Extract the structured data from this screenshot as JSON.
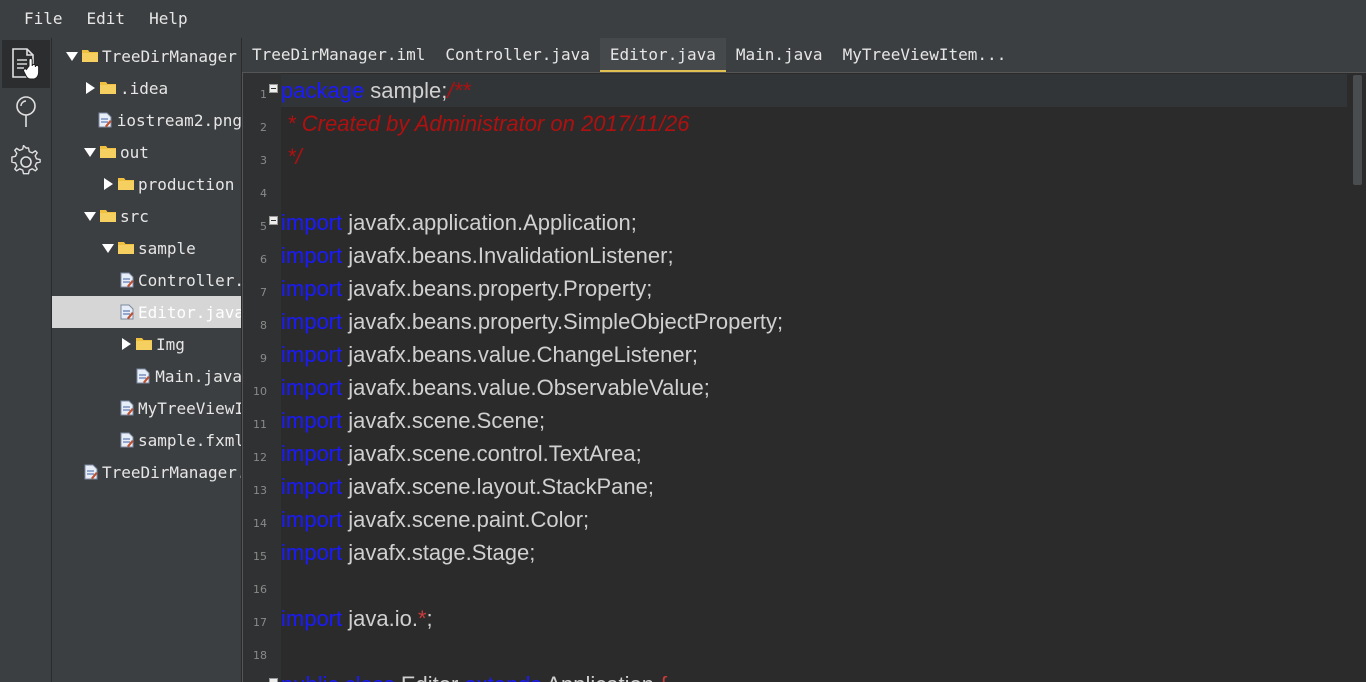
{
  "menu": {
    "items": [
      "File",
      "Edit",
      "Help"
    ]
  },
  "activity": {
    "items": [
      {
        "icon": "files-icon",
        "active": true
      },
      {
        "icon": "search-icon",
        "active": false
      },
      {
        "icon": "gear-icon",
        "active": false
      }
    ]
  },
  "tree": {
    "items": [
      {
        "label": "TreeDirManager",
        "type": "folder",
        "expanded": true
      },
      {
        "label": ".idea",
        "type": "folder",
        "expanded": false
      },
      {
        "label": "iostream2.png",
        "type": "file"
      },
      {
        "label": "out",
        "type": "folder",
        "expanded": true
      },
      {
        "label": "production",
        "type": "folder",
        "expanded": false
      },
      {
        "label": "src",
        "type": "folder",
        "expanded": true
      },
      {
        "label": "sample",
        "type": "folder",
        "expanded": true
      },
      {
        "label": "Controller.java",
        "type": "file"
      },
      {
        "label": "Editor.java",
        "type": "file",
        "selected": true
      },
      {
        "label": "Img",
        "type": "folder",
        "expanded": false
      },
      {
        "label": "Main.java",
        "type": "file"
      },
      {
        "label": "MyTreeViewItem.java",
        "type": "file"
      },
      {
        "label": "sample.fxml",
        "type": "file"
      },
      {
        "label": "TreeDirManager.iml",
        "type": "file"
      }
    ]
  },
  "tabs": {
    "items": [
      "TreeDirManager.iml",
      "Controller.java",
      "Editor.java",
      "Main.java",
      "MyTreeViewItem..."
    ],
    "active_index": 2
  },
  "editor": {
    "line_numbers": [
      "1",
      "2",
      "3",
      "4",
      "5",
      "6",
      "7",
      "8",
      "9",
      "10",
      "11",
      "12",
      "13",
      "14",
      "15",
      "16",
      "17",
      "18"
    ],
    "lines": [
      {
        "k": "package",
        "t": " sample;",
        "c": "/**"
      },
      {
        "k": "",
        "t": "",
        "c": " * Created by Administrator on 2017/11/26"
      },
      {
        "k": "",
        "t": "",
        "c": " */"
      },
      {
        "k": "",
        "t": "",
        "c": ""
      },
      {
        "k": "import",
        "t": " javafx.application.Application;",
        "c": ""
      },
      {
        "k": "import",
        "t": " javafx.beans.InvalidationListener;",
        "c": ""
      },
      {
        "k": "import",
        "t": " javafx.beans.property.Property;",
        "c": ""
      },
      {
        "k": "import",
        "t": " javafx.beans.property.SimpleObjectProperty;",
        "c": ""
      },
      {
        "k": "import",
        "t": " javafx.beans.value.ChangeListener;",
        "c": ""
      },
      {
        "k": "import",
        "t": " javafx.beans.value.ObservableValue;",
        "c": ""
      },
      {
        "k": "import",
        "t": " javafx.scene.Scene;",
        "c": ""
      },
      {
        "k": "import",
        "t": " javafx.scene.control.TextArea;",
        "c": ""
      },
      {
        "k": "import",
        "t": " javafx.scene.layout.StackPane;",
        "c": ""
      },
      {
        "k": "import",
        "t": " javafx.scene.paint.Color;",
        "c": ""
      },
      {
        "k": "import",
        "t": " javafx.stage.Stage;",
        "c": ""
      },
      {
        "k": "",
        "t": "",
        "c": ""
      },
      {
        "k": "import",
        "t": " java.io.",
        "star": "*",
        "t2": ";"
      },
      {
        "k": "",
        "t": "",
        "c": ""
      },
      {
        "k": "public class",
        "t": " Editor ",
        "k2": "extends",
        "t3": " Application ",
        "brace": "{"
      }
    ]
  },
  "colors": {
    "keyword": "#1a1aff",
    "comment": "#b01010",
    "folder": "#f0c040",
    "tab_active_underline": "#e0c050"
  }
}
